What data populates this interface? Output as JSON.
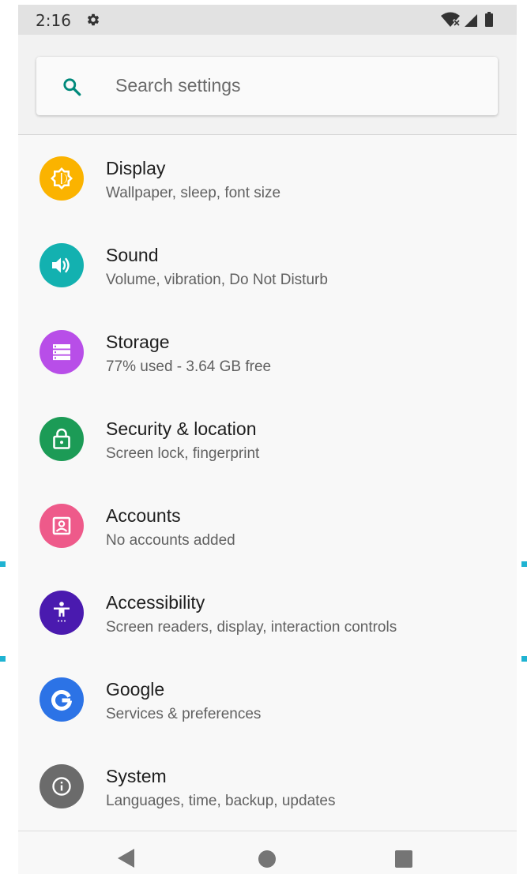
{
  "status_bar": {
    "time": "2:16",
    "settings_icon": "gear-icon",
    "indicator_icons": [
      "wifi-no-internet-icon",
      "cell-signal-icon",
      "battery-icon"
    ]
  },
  "search": {
    "placeholder": "Search settings",
    "icon": "search-icon",
    "accent_color": "#00897b"
  },
  "settings": [
    {
      "title": "Display",
      "subtitle": "Wallpaper, sleep, font size",
      "icon": "display-brightness-icon",
      "color": "#fbb300"
    },
    {
      "title": "Sound",
      "subtitle": "Volume, vibration, Do Not Disturb",
      "icon": "volume-icon",
      "color": "#13b1b0"
    },
    {
      "title": "Storage",
      "subtitle": "77% used - 3.64 GB free",
      "icon": "storage-icon",
      "color": "#b84ee8"
    },
    {
      "title": "Security & location",
      "subtitle": "Screen lock, fingerprint",
      "icon": "lock-icon",
      "color": "#1c9b56"
    },
    {
      "title": "Accounts",
      "subtitle": "No accounts added",
      "icon": "account-box-icon",
      "color": "#ee5a8a"
    },
    {
      "title": "Accessibility",
      "subtitle": "Screen readers, display, interaction controls",
      "icon": "accessibility-icon",
      "color": "#4a1aaf"
    },
    {
      "title": "Google",
      "subtitle": "Services & preferences",
      "icon": "google-g-icon",
      "color": "#2c73e6"
    },
    {
      "title": "System",
      "subtitle": "Languages, time, backup, updates",
      "icon": "info-icon",
      "color": "#6b6b6b"
    }
  ],
  "nav_bar": {
    "icons": [
      "back-icon",
      "home-icon",
      "recents-icon"
    ],
    "color": "#757575"
  }
}
